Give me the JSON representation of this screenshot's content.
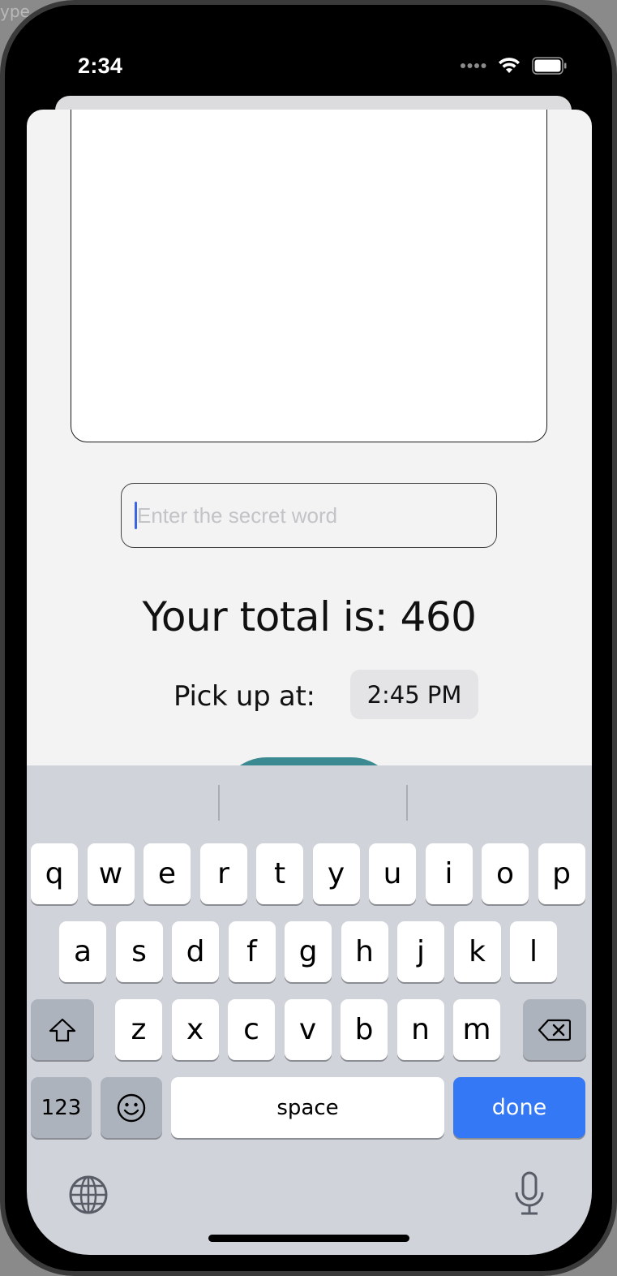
{
  "status_bar": {
    "time": "2:34"
  },
  "background_crumb": "ype",
  "form": {
    "secret_placeholder": "Enter the secret word",
    "total_text": "Your total is: 460",
    "pickup_label": "Pick up at:",
    "pickup_time": "2:45 PM"
  },
  "keyboard": {
    "row1": [
      "q",
      "w",
      "e",
      "r",
      "t",
      "y",
      "u",
      "i",
      "o",
      "p"
    ],
    "row2": [
      "a",
      "s",
      "d",
      "f",
      "g",
      "h",
      "j",
      "k",
      "l"
    ],
    "row3": [
      "z",
      "x",
      "c",
      "v",
      "b",
      "n",
      "m"
    ],
    "numbers_key": "123",
    "space_key": "space",
    "done_key": "done"
  },
  "colors": {
    "done_key": "#3478f6",
    "order_button": "#3b8a92",
    "caret": "#3a63e6"
  }
}
